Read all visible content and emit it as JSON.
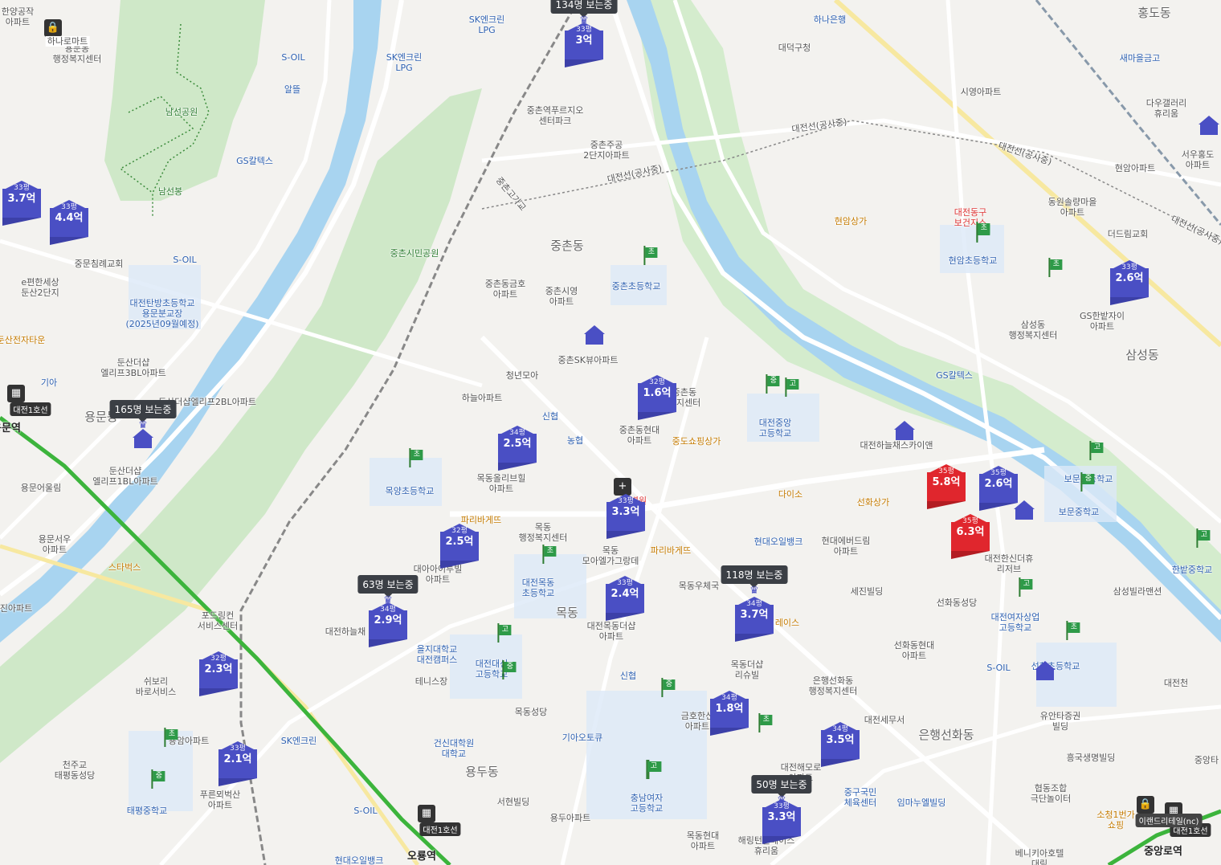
{
  "map": {
    "districts": [
      "중촌동",
      "목동",
      "용문동",
      "용두동",
      "은행선화동",
      "삼성동",
      "홍도동"
    ],
    "labels": {
      "hanyang": "한양공작\n아파트",
      "hanaro": "하나로마트",
      "yongmun_welfare": "용문동\n행정복지센터",
      "namseon_park": "남선공원",
      "namseon_peak": "남선봉",
      "sk_lpg1": "SK엔크린\nLPG",
      "sk_lpg2": "SK엔크린\nLPG",
      "soil1": "S-OIL",
      "alddeul": "알뜰",
      "gs_caltex1": "GS칼텍스",
      "hana_bank": "하나은행",
      "daedeok_office": "대덕구청",
      "saemaeul": "새마을금고",
      "siam_apt": "시영아파트",
      "daou_gallery": "다우갤러리\n휴리움",
      "seoudong_apt": "서우홍도\n아파트",
      "hyunam_apt": "현암아파트",
      "jungchon_pruzio": "중촌역푸르지오\n센터파크",
      "jungchon_jugong": "중촌주공\n2단지아파트",
      "daejeon_line_1": "대전선(공사중)",
      "daejeon_line_2": "대전선(공사중)",
      "daejeon_line_3": "대전선(공사중)",
      "daejeon_line_4": "대전선(공사중)",
      "dongwon": "동원솔량마을\n아파트",
      "deodeurim": "더드림교회",
      "dong_gu_health": "대전동구\n보건지소",
      "hyunam_school": "현암초등학교",
      "hyunam_mall": "현암상가",
      "jungchongogari": "중촌고가교",
      "jungmun_church": "중문침례교회",
      "e_pyeonhan": "e편한세상\n둔산2단지",
      "soil2": "S-OIL",
      "tanbang_school": "대전탄방초등학교\n용문분교장\n(2025년09월예정)",
      "jungchon_park": "중촌시민공원",
      "jungchon_geumho": "중촌동금호\n아파트",
      "jungchon_siyoung": "중촌시영\n아파트",
      "jungchon_school": "중촌초등학교",
      "samsung_welfare": "삼성동\n행정복지센터",
      "gs_hanbat": "GS한밭자이\n아파트",
      "dunsan_electronics": "둔산전자타운",
      "dunsan_3bl": "둔산더샵\n엘리프3BL아파트",
      "dunsan_2bl": "둔산더샵엘리프2BL아파트",
      "kia": "기아",
      "jungchon_sk": "중촌SK뷰아파트",
      "cheongnyeon": "청년모아",
      "haneul_apt": "하늘아파트",
      "jungchon_welfare": "중촌동\n복지센터",
      "shinhyup": "신협",
      "nonghyup": "농협",
      "jungchon_hyundai": "중촌동현대\n아파트",
      "jungdo_mall": "중도쇼핑상가",
      "jungang_high": "대전중앙\n고등학교",
      "gs_caltex2": "GS칼텍스",
      "haneul_sky": "대전하늘채스카이앤",
      "dunsan_1bl": "둔산더샵\n엘리프1BL아파트",
      "yongmun_eoullim": "용문어울림",
      "mokyang_school": "목양초등학교",
      "mokdong_olive": "목동올리브힐\n아파트",
      "paris1": "파리바게뜨",
      "mokdong_welfare": "목동\n행정복지센터",
      "hospital": "병원",
      "daiso": "다이소",
      "seonhwa_mall": "선화상가",
      "bomun_school": "보문초등학교",
      "bomun_middle": "보문중학교",
      "yongmun_seowoo": "용문서우\n아파트",
      "starbucks": "스타벅스",
      "paris2": "파리바게뜨",
      "mokdong_moaelga": "목동\n모아엘가그랑데",
      "hyundai_oil": "현대오일뱅크",
      "hyundai_everdream": "현대에버드림\n아파트",
      "hansin_the_hue": "대전한신더휴\n리저브",
      "daea_apt": "대아아이투빌\n아파트",
      "mokdong_school": "대전목동\n초등학교",
      "mokdong_post": "목동우체국",
      "sejin": "세진빌딩",
      "seonhwa_church": "선화동성당",
      "samsung_villa": "삼성빌라맨션",
      "hanbat_middle": "한밭중학교",
      "jinapt": "진아파트",
      "ford": "포드링컨\n서비스센터",
      "haneulchae_apt": "대전하늘채",
      "euji_univ": "을지대학교\n대전캠퍼스",
      "tennis": "테니스장",
      "daesin_high": "대전대신\n고등학교",
      "mokdong_thesharp": "대전목동더샵\n아파트",
      "mokdong_thesharp2": "목동더샵\n리슈빌",
      "eunhaeng_welfare": "은행선화동\n행정복지센터",
      "seonhwa_hyundai": "선화동현대\n아파트",
      "yeoja_high": "대전여자상업\n고등학교",
      "soil3": "S-OIL",
      "seonhwa_school": "선화초등학교",
      "daejeon_station_area": "대전천",
      "yuanta": "유안타증권\n빌딩",
      "shinhyup2": "신협",
      "swiri": "쉬보리\n바로서비스",
      "mokdong_cathedral": "목동성당",
      "kia_autoq": "기아오토큐",
      "kumho_apt": "금호한신\n아파트",
      "daejeon_tax": "대전세무서",
      "heungkuk": "흥국생명빌딩",
      "jungang_tower": "중앙타",
      "yongam": "용암아파트",
      "cheonju_church": "천주교\n태평동성당",
      "sk_encleen": "SK엔크린",
      "geonyang_univ": "건신대학원\n대학교",
      "chungnam_girls": "충남여자\n고등학교",
      "daejeon_haemoro": "대전해모로\n아파트",
      "jungu_gymnasium": "중구국민\n체육센터",
      "imma_bldg": "임마누엘빌딩",
      "hyupdong": "협동조합\n극단놀이터",
      "sochung": "소청1번가\n쇼핑",
      "pureun_apt": "푸른뫼벅산\n아파트",
      "taepyeong_middle": "태평중학교",
      "soil4": "S-OIL",
      "seohyun": "서현빌딩",
      "yongdu_apt": "용두아파트",
      "mokdong_hyundai": "목동현대\n아파트",
      "haering": "해링턴플레이스\n휴리움",
      "hyundai_oil2": "현대오일뱅크",
      "veneziano": "베니키아호텔\n대림",
      "line1_label": "대전1호선",
      "station_oryong": "오룡역",
      "station_jungang": "중앙로역",
      "station_yongmun": "용문역",
      "eland": "이랜드리테일(nc)",
      "place_mall": "레이스"
    },
    "price_markers": [
      {
        "size": "33평",
        "price": "3억",
        "color": "blue"
      },
      {
        "size": "33평",
        "price": "3.7억",
        "color": "blue"
      },
      {
        "size": "33평",
        "price": "4.4억",
        "color": "blue"
      },
      {
        "size": "33평",
        "price": "2.6억",
        "color": "blue"
      },
      {
        "size": "32평",
        "price": "1.6억",
        "color": "blue"
      },
      {
        "size": "34평",
        "price": "2.5억",
        "color": "blue"
      },
      {
        "size": "35평",
        "price": "5.8억",
        "color": "red"
      },
      {
        "size": "35평",
        "price": "2.6억",
        "color": "blue"
      },
      {
        "size": "35평",
        "price": "6.3억",
        "color": "red"
      },
      {
        "size": "33평",
        "price": "3.3억",
        "color": "blue"
      },
      {
        "size": "32평",
        "price": "2.5억",
        "color": "blue"
      },
      {
        "size": "33평",
        "price": "2.4억",
        "color": "blue"
      },
      {
        "size": "34평",
        "price": "3.7억",
        "color": "blue"
      },
      {
        "size": "34평",
        "price": "2.9억",
        "color": "blue"
      },
      {
        "size": "32평",
        "price": "2.3억",
        "color": "blue"
      },
      {
        "size": "34평",
        "price": "1.8억",
        "color": "blue"
      },
      {
        "size": "34평",
        "price": "3.5억",
        "color": "blue"
      },
      {
        "size": "33평",
        "price": "2.1억",
        "color": "blue"
      },
      {
        "size": "33평",
        "price": "3.3억",
        "color": "blue"
      }
    ],
    "viewers": [
      "134명 보는중",
      "165명 보는중",
      "63명 보는중",
      "118명 보는중",
      "50명 보는중"
    ],
    "flags": [
      "초",
      "초",
      "초",
      "중",
      "고",
      "초",
      "고",
      "초",
      "중",
      "고",
      "초",
      "고",
      "중",
      "고",
      "초",
      "중",
      "고",
      "초",
      "중",
      "고",
      "초",
      "중"
    ]
  },
  "colors": {
    "water": "#a8d4f0",
    "park": "#cfe8c8",
    "road": "#ffffff",
    "rail": "#888888",
    "line1": "#3cb43c",
    "marker_blue": "#4a4fc4",
    "marker_red": "#e0262d"
  }
}
